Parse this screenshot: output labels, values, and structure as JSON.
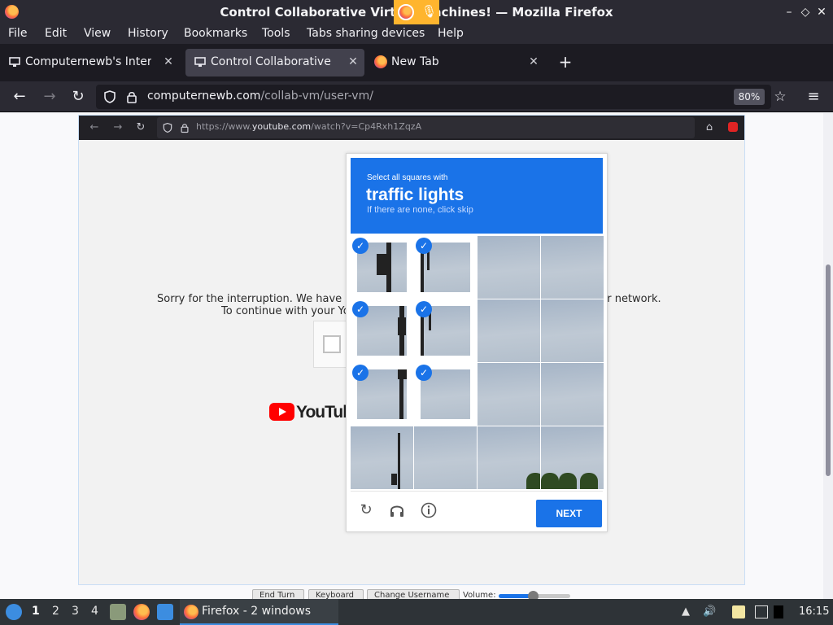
{
  "window": {
    "title": "Control Collaborative Virtual Machines! — Mozilla Firefox",
    "buttons": {
      "minimize": "–",
      "restore": "◇",
      "close": "✕"
    }
  },
  "menu": {
    "items": [
      {
        "label": "File",
        "key": "F"
      },
      {
        "label": "Edit",
        "key": "E"
      },
      {
        "label": "View",
        "key": "V"
      },
      {
        "label": "History",
        "key": "s"
      },
      {
        "label": "Bookmarks",
        "key": "B"
      },
      {
        "label": "Tools",
        "key": "T"
      },
      {
        "label": "Tabs sharing devices",
        "key": "d"
      },
      {
        "label": "Help",
        "key": "H"
      }
    ]
  },
  "tabs": [
    {
      "label": "Computernewb's Internet",
      "active": false,
      "icon": "computernewb-icon"
    },
    {
      "label": "Control Collaborative Virtual",
      "active": true,
      "icon": "computernewb-icon"
    },
    {
      "label": "New Tab",
      "active": false,
      "icon": "firefox-icon"
    }
  ],
  "nav": {
    "url_domain": "computernewb.com",
    "url_path": "/collab-vm/user-vm/",
    "zoom": "80%"
  },
  "vm": {
    "url_prefix": "https://www.",
    "url_domain": "youtube.com",
    "url_path": "/watch?v=Cp4Rxh1ZqzA",
    "sorry_line1": "Sorry for the interruption. We have b",
    "sorry_line1_end": "ur network.",
    "sorry_line2": "To continue with your Yo",
    "youtube_word": "YouTube",
    "controls": {
      "end_turn": "End Turn",
      "keyboard": "Keyboard",
      "change_username": "Change Username",
      "volume_label": "Volume:",
      "volume_level": 0.48
    }
  },
  "captcha": {
    "line1": "Select all squares with",
    "line2": "traffic lights",
    "line3": "If there are none, click skip",
    "next_label": "NEXT",
    "selected_tiles": [
      0,
      1,
      4,
      5,
      8,
      9
    ],
    "check_mark": "✓"
  },
  "taskbar": {
    "workspaces": [
      "1",
      "2",
      "3",
      "4"
    ],
    "active_workspace": "1",
    "task_label": "Firefox - 2 windows",
    "clock": "16:15"
  },
  "colors": {
    "accent": "#1a73e8",
    "youtube_red": "#ff0000",
    "chrome_dark": "#2b2a33"
  }
}
